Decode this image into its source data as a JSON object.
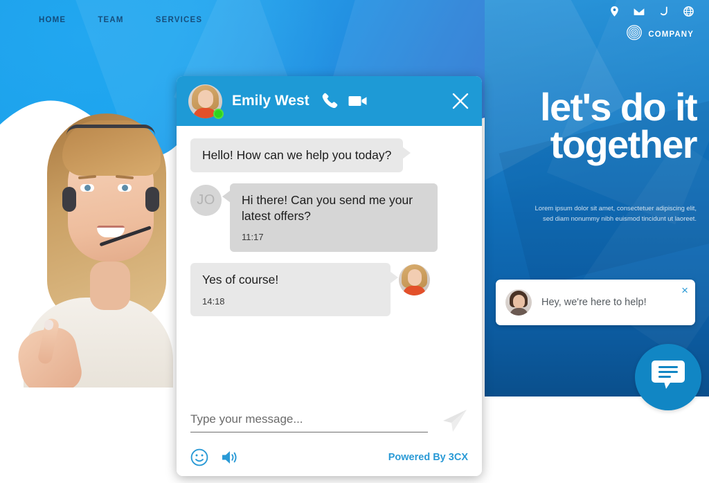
{
  "site": {
    "nav": [
      {
        "label": "HOME",
        "name": "nav-home"
      },
      {
        "label": "TEAM",
        "name": "nav-team"
      },
      {
        "label": "SERVICES",
        "name": "nav-services"
      }
    ],
    "corner_icons": [
      "location-pin-icon",
      "envelope-icon",
      "phone-icon",
      "globe-icon"
    ],
    "brand": {
      "name": "COMPANY",
      "logo_icon": "spiral-target-logo-icon"
    },
    "headline_line1": "let's do it",
    "headline_line2": "together",
    "subcopy": "Lorem ipsum dolor sit amet, consectetuer adipiscing elit, sed diam nonummy nibh euismod tincidunt ut laoreet.",
    "hero_photo_alt": "support-agent-with-headset"
  },
  "greeting": {
    "text": "Hey, we're here to help!",
    "close_label": "×",
    "avatar_alt": "agent-avatar"
  },
  "fab": {
    "icon": "chat-bubble-icon",
    "label": "Open chat"
  },
  "chat": {
    "header": {
      "agent_name": "Emily West",
      "status": "online",
      "call_icon": "phone-icon",
      "video_icon": "video-camera-icon",
      "close_icon": "close-icon"
    },
    "messages": [
      {
        "id": "m1",
        "side": "agent",
        "text": "Hello! How can we help you today?",
        "time": "",
        "avatar": "",
        "initials": ""
      },
      {
        "id": "m2",
        "side": "user",
        "text": "Hi there! Can you send me your latest offers?",
        "time": "11:17",
        "avatar": "",
        "initials": "JO"
      },
      {
        "id": "m3",
        "side": "agent",
        "text": "Yes of course!",
        "time": "14:18",
        "avatar": "agent-photo",
        "initials": ""
      }
    ],
    "composer": {
      "placeholder": "Type your message...",
      "value": "",
      "send_icon": "send-paper-plane-icon",
      "emoji_icon": "smiley-face-icon",
      "sound_icon": "speaker-sound-icon",
      "powered_by": "Powered By 3CX"
    }
  },
  "colors": {
    "brand_blue": "#1e9ad6",
    "panel_blue": "#0d5fa6",
    "hero_blue": "#19a3ee",
    "link_blue": "#2a9ad6",
    "bubble_grey": "#e8e8e8",
    "bubble_grey_dark": "#d6d6d6",
    "status_green": "#2fd41f"
  }
}
